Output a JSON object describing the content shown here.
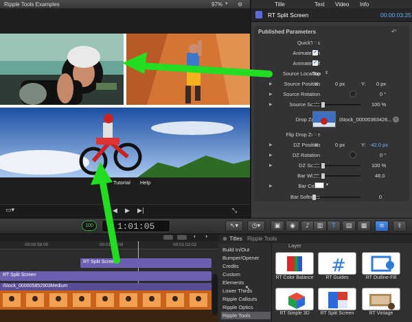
{
  "viewer": {
    "title": "Ripple Tools Examples",
    "zoom": "97%",
    "menu": [
      "Tutorial",
      "Help"
    ]
  },
  "inspector": {
    "tabs": [
      "Title",
      "Text",
      "Video",
      "Info"
    ],
    "effect_name": "RT Split Screen",
    "timecode": "00:00:03:25",
    "section_title": "Published Parameters",
    "params": {
      "quicktips": "QuickTips",
      "animate_on": "Animate On",
      "animate_off": "Animate Off",
      "source_location": "Source Location",
      "source_location_value": "Top",
      "source_position": "Source Position",
      "source_rotation": "Source Rotation",
      "source_scale": "Source Scale",
      "source_scale_value": "100 %",
      "drop_zone": "Drop Zone",
      "drop_zone_value": "iStock_00000363426...",
      "flip_drop_zone": "Flip Drop Zone",
      "dz_position": "DZ Position",
      "dz_rotation": "DZ Rotation",
      "dz_scale": "DZ Scale",
      "dz_scale_value": "100 %",
      "bar_width": "Bar Width",
      "bar_width_value": "46.0",
      "bar_color": "Bar Color",
      "bar_softness": "Bar Softness",
      "bar_softness_value": "0",
      "x_label": "X:",
      "y_label": "Y:",
      "zero_px": "0 px",
      "dz_x_value": "0 px",
      "dz_y_value": "-42.0 px",
      "zero_deg": "0 °"
    },
    "levels": {
      "source_scale": 0.2,
      "dz_scale": 0.2,
      "bar_width": 0.2,
      "bar_softness": 0.0
    },
    "checked": {
      "quicktips": false,
      "animate_on": true,
      "animate_off": true,
      "flip_drop_zone": false
    }
  },
  "toolbar": {
    "percent_badge": "100",
    "timecode": "1:01:05",
    "icons": [
      "select-tool-icon",
      "retime-icon",
      "clip-icon",
      "camera-icon",
      "music-icon",
      "transitions-icon",
      "titles-icon",
      "generators-icon",
      "themes-icon",
      "inspector-icon",
      "share-icon"
    ]
  },
  "timeline": {
    "ruler": [
      "00:00:58:00",
      "00:01:00:00",
      "00:01:02:02"
    ],
    "title_clip": "RT Split Screen",
    "title_clip_lower": "RT Split Screen",
    "video_clip": "iStock_000005852903Medium"
  },
  "browser": {
    "header": "Titles",
    "subheader": "Ripple Tools",
    "categories": [
      "Build In/Out",
      "Bumper/Opener",
      "Credits",
      "Custom",
      "Elements",
      "Lower Thirds",
      "Ripple Callouts",
      "Ripple Optics",
      "Ripple Tools"
    ],
    "selected": "Ripple Tools",
    "layer_label": "Layer",
    "items": [
      "RT Color Balance",
      "RT Guides",
      "RT Outline-Fill",
      "RT Simple 3D",
      "RT Split Screen",
      "RT Vintage"
    ]
  },
  "colors": {
    "accent_blue": "#4f8fe6",
    "arrow_green": "#22dd22",
    "timecode_blue": "#6cb1ff"
  }
}
